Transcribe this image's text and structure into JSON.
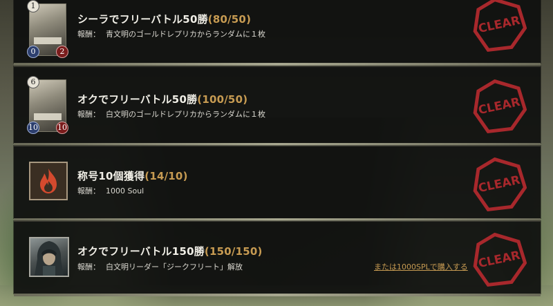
{
  "missions": [
    {
      "title": "シーラでフリーバトル50勝",
      "progress": "(80/50)",
      "reward_label": "報酬：",
      "reward": "青文明のゴールドレプリカからランダムに１枚",
      "card": {
        "cost": "1",
        "attack": "0",
        "defense": "2"
      },
      "clear_text": "CLEAR"
    },
    {
      "title": "オクでフリーバトル50勝",
      "progress": "(100/50)",
      "reward_label": "報酬：",
      "reward": "白文明のゴールドレプリカからランダムに１枚",
      "card": {
        "cost": "6",
        "attack": "10",
        "defense": "10"
      },
      "clear_text": "CLEAR"
    },
    {
      "title": "称号10個獲得",
      "progress": "(14/10)",
      "reward_label": "報酬：",
      "reward": "1000 Soul",
      "icon": "fire-icon",
      "clear_text": "CLEAR"
    },
    {
      "title": "オクでフリーバトル150勝",
      "progress": "(150/150)",
      "reward_label": "報酬：",
      "reward": "白文明リーダー「ジークフリート」解放",
      "icon": "hooded-leader-portrait",
      "purchase_link": "または1000SPLで購入する",
      "clear_text": "CLEAR"
    }
  ],
  "colors": {
    "progress": "#c79b52",
    "stamp_red": "#a8282c",
    "panel_bg": "#0e0f0e"
  }
}
